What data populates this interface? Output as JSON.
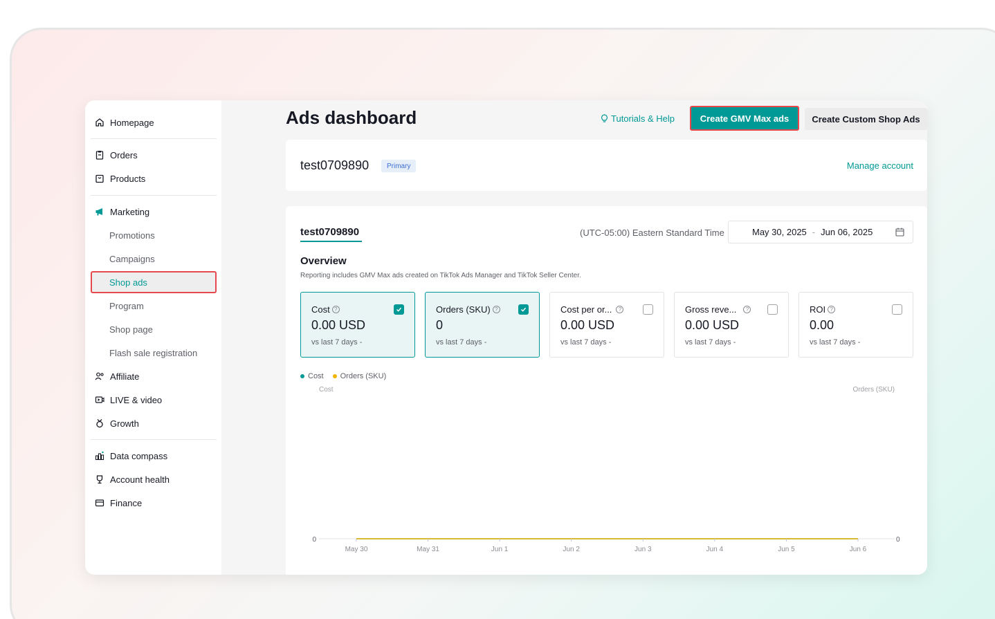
{
  "sidebar": {
    "items": [
      {
        "label": "Homepage",
        "icon": "home-icon"
      },
      {
        "label": "Orders",
        "icon": "clipboard-icon"
      },
      {
        "label": "Products",
        "icon": "box-icon"
      },
      {
        "label": "Marketing",
        "icon": "megaphone-icon"
      },
      {
        "label": "Affiliate",
        "icon": "people-icon"
      },
      {
        "label": "LIVE & video",
        "icon": "video-icon"
      },
      {
        "label": "Growth",
        "icon": "medal-icon"
      },
      {
        "label": "Data compass",
        "icon": "chart-icon"
      },
      {
        "label": "Account health",
        "icon": "trophy-icon"
      },
      {
        "label": "Finance",
        "icon": "card-icon"
      }
    ],
    "marketing_sub": [
      "Promotions",
      "Campaigns",
      "Shop ads",
      "Program",
      "Shop page",
      "Flash sale registration"
    ],
    "active": "Shop ads"
  },
  "header": {
    "title": "Ads dashboard",
    "help_label": "Tutorials & Help",
    "gmv_button": "Create GMV Max ads",
    "custom_button": "Create Custom Shop Ads"
  },
  "account": {
    "name": "test0709890",
    "badge": "Primary",
    "manage_label": "Manage account"
  },
  "report": {
    "tab": "test0709890",
    "timezone": "(UTC-05:00) Eastern Standard Time",
    "date_start": "May 30, 2025",
    "date_sep": "-",
    "date_end": "Jun 06, 2025",
    "overview_title": "Overview",
    "overview_desc": "Reporting includes GMV Max ads created on TikTok Ads Manager and TikTok Seller Center.",
    "metrics": [
      {
        "label": "Cost",
        "value": "0.00 USD",
        "vs": "vs last 7 days -",
        "selected": true
      },
      {
        "label": "Orders (SKU)",
        "value": "0",
        "vs": "vs last 7 days -",
        "selected": true
      },
      {
        "label": "Cost per or...",
        "value": "0.00 USD",
        "vs": "vs last 7 days -",
        "selected": false
      },
      {
        "label": "Gross reve...",
        "value": "0.00 USD",
        "vs": "vs last 7 days -",
        "selected": false
      },
      {
        "label": "ROI",
        "value": "0.00",
        "vs": "vs last 7 days -",
        "selected": false
      }
    ]
  },
  "colors": {
    "accent": "#009995",
    "highlight": "#e5484d",
    "orders_series": "#f5b400"
  },
  "chart_data": {
    "type": "line",
    "x": [
      "May 30",
      "May 31",
      "Jun 1",
      "Jun 2",
      "Jun 3",
      "Jun 4",
      "Jun 5",
      "Jun 6"
    ],
    "series": [
      {
        "name": "Cost",
        "values": [
          0,
          0,
          0,
          0,
          0,
          0,
          0,
          0
        ]
      },
      {
        "name": "Orders (SKU)",
        "values": [
          0,
          0,
          0,
          0,
          0,
          0,
          0,
          0
        ]
      }
    ],
    "ylabel": "Cost",
    "y2label": "Orders (SKU)",
    "y_ticks": [
      "0"
    ],
    "y2_ticks": [
      "0"
    ],
    "legend": "top-left"
  }
}
